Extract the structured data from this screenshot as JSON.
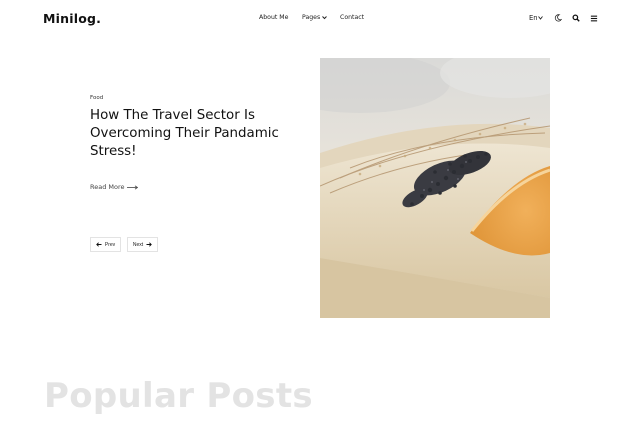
{
  "header": {
    "logo": "Minilog.",
    "nav": {
      "about": "About Me",
      "pages": "Pages",
      "contact": "Contact"
    },
    "language": "En",
    "icons": {
      "pages_dropdown": "chevron-down-icon",
      "language_dropdown": "chevron-down-icon",
      "theme_toggle": "moon-icon",
      "search": "search-icon",
      "menu": "hamburger-menu-icon"
    }
  },
  "featured": {
    "category": "Food",
    "title": "How The Travel Sector Is Overcoming Their Pandamic Stress!",
    "read_more": "Read More",
    "pagination": {
      "prev": "Prev",
      "next": "Next"
    },
    "image": "lavender-sprig-on-wooden-board-with-orange-slice"
  },
  "sections": {
    "popular_heading": "Popular Posts"
  },
  "colors": {
    "text": "#111111",
    "muted_heading": "#e3e3e3",
    "button_border": "#e3e3e3",
    "background": "#ffffff"
  }
}
